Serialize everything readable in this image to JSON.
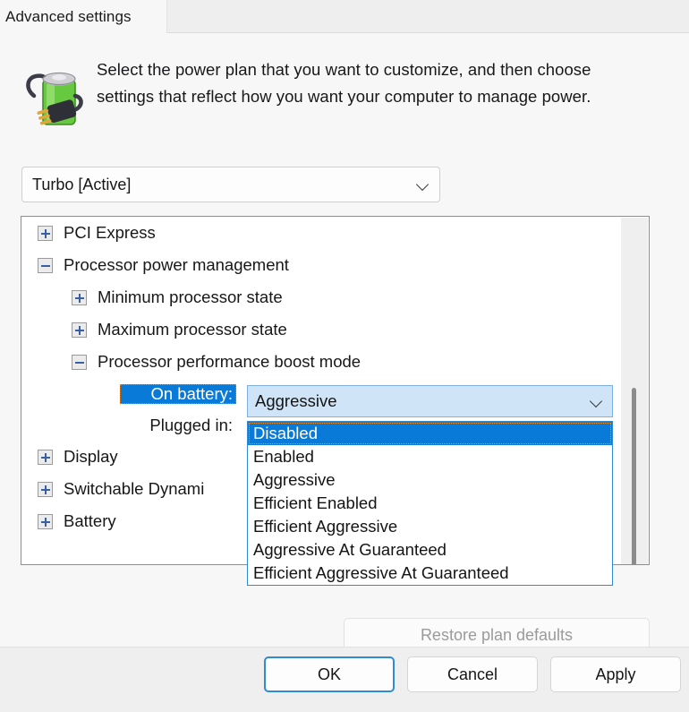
{
  "window": {
    "tab_label": "Advanced settings"
  },
  "header": {
    "icon": "battery-plug-icon",
    "description": "Select the power plan that you want to customize, and then choose settings that reflect how you want your computer to manage power."
  },
  "plan_select": {
    "name": "power-plan-select",
    "value": "Turbo [Active]",
    "chevron": "chevron-down-icon"
  },
  "tree": {
    "rows": [
      {
        "label": "PCI Express",
        "state": "collapsed",
        "indent": 0
      },
      {
        "label": "Processor power management",
        "state": "expanded",
        "indent": 0
      },
      {
        "label": "Minimum processor state",
        "state": "collapsed",
        "indent": 1
      },
      {
        "label": "Maximum processor state",
        "state": "collapsed",
        "indent": 1
      },
      {
        "label": "Processor performance boost mode",
        "state": "expanded",
        "indent": 1
      },
      {
        "label": "Display",
        "state": "collapsed",
        "indent": 0
      },
      {
        "label": "Switchable Dynami",
        "state": "collapsed",
        "indent": 0
      },
      {
        "label": "Battery",
        "state": "collapsed",
        "indent": 0
      }
    ],
    "settings": {
      "on_battery_label": "On battery:",
      "plugged_in_label": "Plugged in:"
    }
  },
  "value_combo": {
    "name": "on-battery-value-combo",
    "value": "Aggressive",
    "chevron": "chevron-down-icon"
  },
  "dropdown": {
    "open": true,
    "selected_index": 0,
    "options": [
      "Disabled",
      "Enabled",
      "Aggressive",
      "Efficient Enabled",
      "Efficient Aggressive",
      "Aggressive At Guaranteed",
      "Efficient Aggressive At Guaranteed"
    ]
  },
  "restore_button": {
    "label": "Restore plan defaults",
    "enabled": false
  },
  "footer": {
    "ok": "OK",
    "cancel": "Cancel",
    "apply": "Apply"
  },
  "colors": {
    "selection_blue": "#0a7ad9",
    "focus_dotted": "#e8953a",
    "combo_fill": "#cfe4f7",
    "dropdown_border": "#2f8ad8",
    "window_bg": "#f7f7f7",
    "footer_bg": "#efefef",
    "disabled_text": "#9a9a9a"
  }
}
